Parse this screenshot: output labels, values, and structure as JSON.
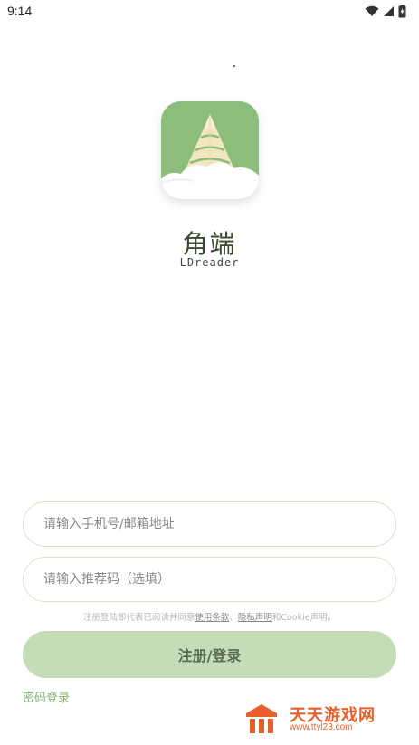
{
  "status_bar": {
    "time": "9:14",
    "icons": [
      "wifi-icon",
      "signal-icon",
      "battery-charging-icon"
    ]
  },
  "app": {
    "name": "角端",
    "subtitle": "LDreader",
    "icon": "app-logo-icon",
    "icon_color": "#8dbd7b"
  },
  "form": {
    "phone_email_placeholder": "请输入手机号/邮箱地址",
    "phone_email_value": "",
    "referral_placeholder": "请输入推荐码（选填）",
    "referral_value": ""
  },
  "agreement": {
    "prefix": "注册登陆即代表已阅读并同意",
    "terms_link": "使用条款",
    "separator": "、",
    "privacy_link": "隐私声明",
    "suffix": "和Cookie声明。"
  },
  "actions": {
    "submit_label": "注册/登录",
    "password_login_label": "密码登录"
  },
  "watermark": {
    "text": "天天游戏网",
    "url": "www.ttyl23.com",
    "color": "#e85f2b"
  },
  "colors": {
    "accent": "#8dbd7b",
    "button_bg": "#c4dcb8",
    "link_green": "#86b27a"
  }
}
